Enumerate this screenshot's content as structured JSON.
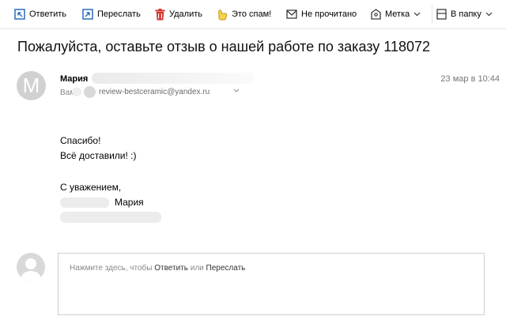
{
  "toolbar": {
    "reply_label": "Ответить",
    "forward_label": "Переслать",
    "delete_label": "Удалить",
    "spam_label": "Это спам!",
    "unread_label": "Не прочитано",
    "label_label": "Метка",
    "folder_label": "В папку"
  },
  "message": {
    "subject": "Пожалуйста, оставьте отзыв о нашей работе по заказу 118072",
    "avatar_letter": "M",
    "sender_name": "Мария",
    "to_label": "Вам:",
    "to_address": "review-bestceramic@yandex.ru",
    "date": "23 мар в 10:44",
    "body_lines": [
      "Спасибо!",
      "Всё доставили! :)",
      "С уважением,",
      "Мария"
    ]
  },
  "reply": {
    "prompt_prefix": "Нажмите здесь, чтобы",
    "reply_link": "Ответить",
    "or_text": "или",
    "forward_link": "Переслать"
  },
  "colors": {
    "reply_icon": "#2d6cc0",
    "forward_icon": "#2d6cc0",
    "delete_icon": "#d2322d",
    "spam_icon": "#e8b51a",
    "avatar_bg": "#d1d1d1"
  }
}
